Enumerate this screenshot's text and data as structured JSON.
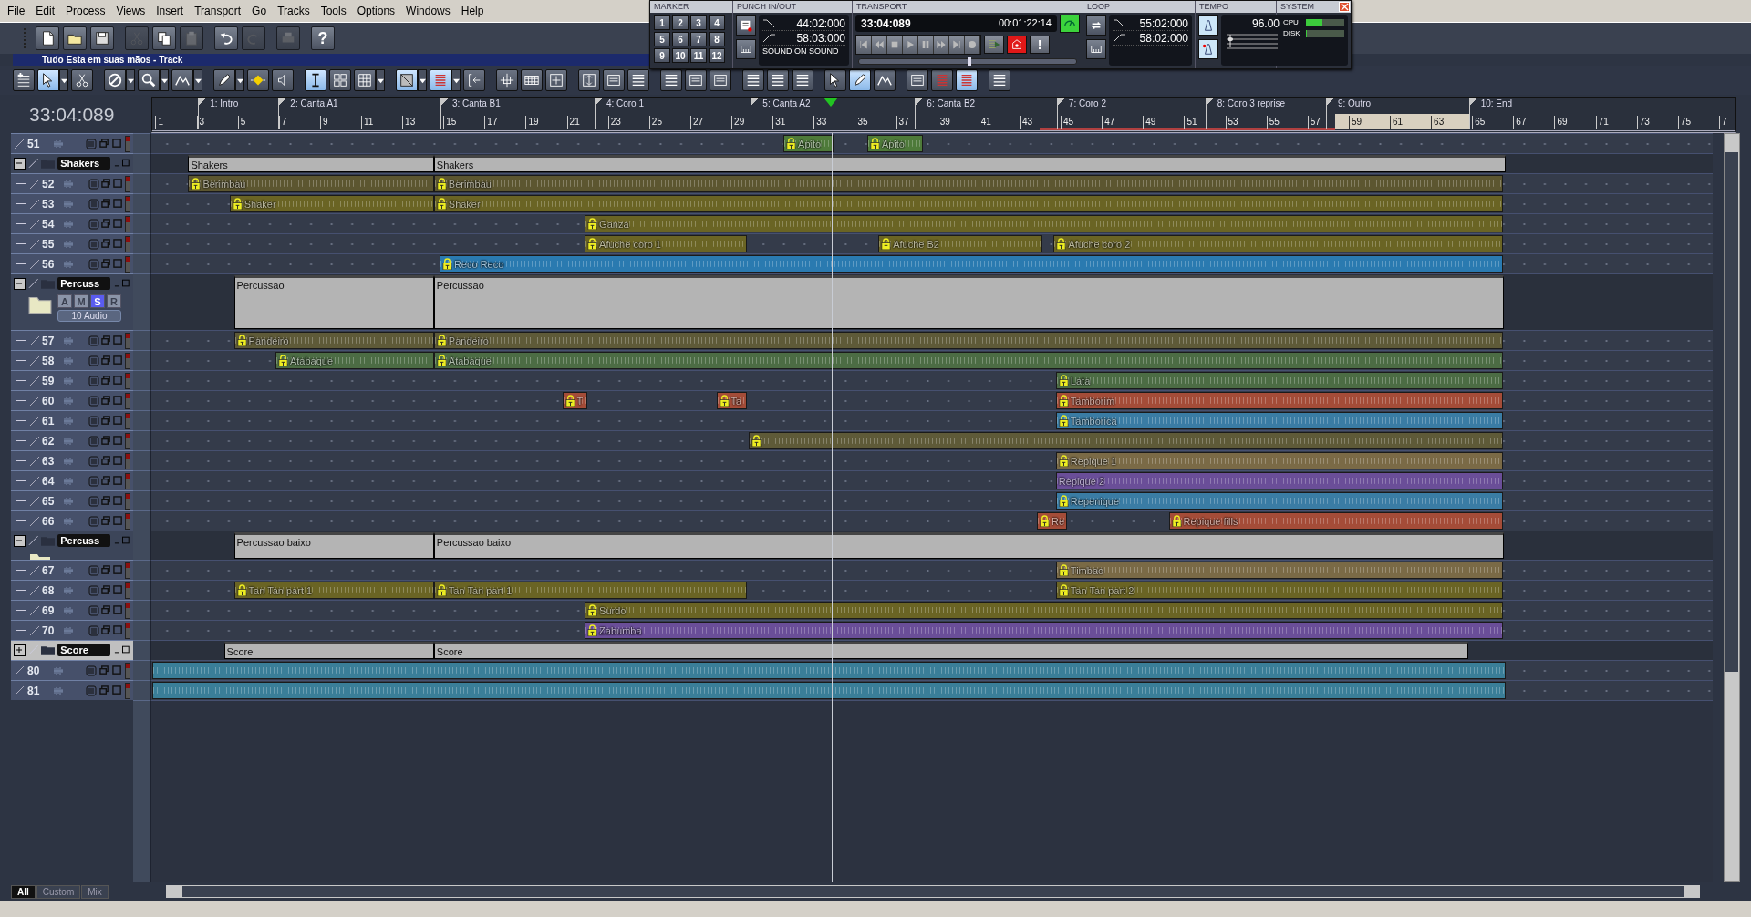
{
  "menu": [
    "File",
    "Edit",
    "Process",
    "Views",
    "Insert",
    "Transport",
    "Go",
    "Tracks",
    "Tools",
    "Options",
    "Windows",
    "Help"
  ],
  "toolbar": [
    {
      "kind": "new",
      "disabled": false
    },
    {
      "kind": "open",
      "disabled": false
    },
    {
      "kind": "save",
      "disabled": false
    },
    {
      "kind": "cut",
      "disabled": true
    },
    {
      "kind": "copy",
      "disabled": false
    },
    {
      "kind": "paste",
      "disabled": true
    },
    {
      "kind": "undo",
      "disabled": false
    },
    {
      "kind": "redo",
      "disabled": true
    },
    {
      "kind": "print",
      "disabled": true
    },
    {
      "kind": "help",
      "label": "?",
      "disabled": false
    }
  ],
  "document_title": "Tudo Esta em suas mãos - Track",
  "track_toolbar": [
    {
      "kind": "add-track",
      "dropdown": false,
      "selected": false
    },
    {
      "kind": "pointer",
      "dropdown": true,
      "selected": true
    },
    {
      "kind": "scissors",
      "dropdown": false,
      "selected": false
    },
    {
      "kind": "no-entry",
      "dropdown": true,
      "selected": false
    },
    {
      "kind": "search",
      "dropdown": true,
      "selected": false
    },
    {
      "kind": "curve",
      "dropdown": true,
      "selected": false
    },
    {
      "kind": "pencil",
      "dropdown": true,
      "selected": false
    },
    {
      "kind": "diamond",
      "dropdown": false,
      "selected": false
    },
    {
      "kind": "speaker",
      "dropdown": false,
      "selected": false
    },
    {
      "kind": "text-cursor",
      "dropdown": false,
      "selected": true
    },
    {
      "kind": "four-squares",
      "dropdown": false,
      "selected": false
    },
    {
      "kind": "grid",
      "dropdown": true,
      "selected": false
    },
    {
      "kind": "split-square",
      "dropdown": true,
      "selected": true
    },
    {
      "kind": "bars",
      "dropdown": true,
      "selected": true
    },
    {
      "kind": "bracket-arrow",
      "dropdown": false,
      "selected": false
    },
    {
      "kind": "move",
      "dropdown": false,
      "selected": false
    },
    {
      "kind": "film",
      "dropdown": false,
      "selected": false
    },
    {
      "kind": "expand-horizontal",
      "dropdown": false,
      "selected": false
    },
    {
      "kind": "expand-vertical",
      "dropdown": false,
      "selected": false
    },
    {
      "kind": "panel",
      "dropdown": false,
      "selected": false
    },
    {
      "kind": "list",
      "dropdown": false,
      "selected": false
    },
    {
      "kind": "list",
      "dropdown": false,
      "selected": false
    },
    {
      "kind": "panel",
      "dropdown": false,
      "selected": false
    },
    {
      "kind": "panel",
      "dropdown": false,
      "selected": false
    },
    {
      "kind": "list",
      "dropdown": false,
      "selected": false
    },
    {
      "kind": "list",
      "dropdown": false,
      "selected": false
    },
    {
      "kind": "list",
      "dropdown": false,
      "selected": false
    },
    {
      "kind": "pointer",
      "dropdown": false,
      "selected": false
    },
    {
      "kind": "pencil",
      "dropdown": false,
      "selected": true
    },
    {
      "kind": "curve",
      "dropdown": false,
      "selected": false
    },
    {
      "kind": "panel",
      "dropdown": false,
      "selected": false
    },
    {
      "kind": "bars",
      "dropdown": false,
      "selected": false
    },
    {
      "kind": "bars",
      "dropdown": false,
      "selected": true
    },
    {
      "kind": "list",
      "dropdown": false,
      "selected": false
    }
  ],
  "time_display": "33:04:089",
  "ruler": {
    "markers": [
      "1: Intro",
      "2: Canta A1",
      "3: Canta B1",
      "4: Coro 1",
      "5: Canta A2",
      "6: Canta B2",
      "7: Coro 2",
      "8: Coro 3 reprise",
      "9: Outro",
      "10: End"
    ],
    "measures": [
      "1",
      "3",
      "5",
      "7",
      "9",
      "11",
      "13",
      "15",
      "17",
      "19",
      "21",
      "23",
      "25",
      "27",
      "29",
      "31",
      "33",
      "35",
      "37",
      "39",
      "41",
      "43",
      "45",
      "47",
      "49",
      "51",
      "53",
      "55",
      "57",
      "59",
      "61",
      "63",
      "65",
      "67",
      "69",
      "71",
      "73",
      "75",
      "7"
    ]
  },
  "tracks": [
    {
      "kind": "track",
      "number": "51",
      "clips": [
        {
          "name": "Apito",
          "color": "#4e7a3a",
          "locked": true
        },
        {
          "name": "Apito",
          "color": "#4e7a3a",
          "locked": true
        }
      ]
    },
    {
      "kind": "folder",
      "name": "Shakers",
      "expanded": true,
      "clips": [
        {
          "name": "Shakers",
          "color": "#b4b4b4"
        },
        {
          "name": "Shakers",
          "color": "#b4b4b4"
        }
      ],
      "children": [
        {
          "kind": "track",
          "number": "52",
          "clips": [
            {
              "name": "Berimbau",
              "color": "#5c5630",
              "locked": true
            },
            {
              "name": "Berimbau",
              "color": "#5c5630",
              "locked": true
            }
          ]
        },
        {
          "kind": "track",
          "number": "53",
          "clips": [
            {
              "name": "Shaker",
              "color": "#6a6424",
              "locked": true
            },
            {
              "name": "Shaker",
              "color": "#6a6424",
              "locked": true
            }
          ]
        },
        {
          "kind": "track",
          "number": "54",
          "clips": [
            {
              "name": "Ganza",
              "color": "#6a6424",
              "locked": true
            }
          ]
        },
        {
          "kind": "track",
          "number": "55",
          "clips": [
            {
              "name": "Afuche coro 1",
              "color": "#6a6424",
              "locked": true
            },
            {
              "name": "Afuche B2",
              "color": "#6a6424",
              "locked": true
            },
            {
              "name": "Afuche coro 2",
              "color": "#6a6424",
              "locked": true
            }
          ]
        },
        {
          "kind": "track",
          "number": "56",
          "clips": [
            {
              "name": "Reco Reco",
              "color": "#2a7ab0",
              "locked": true
            }
          ]
        }
      ]
    },
    {
      "kind": "folder",
      "name": "Percuss",
      "expanded": true,
      "buttons": [
        {
          "label": "A",
          "on": false
        },
        {
          "label": "M",
          "on": false
        },
        {
          "label": "S",
          "on": true
        },
        {
          "label": "R",
          "on": false
        }
      ],
      "summary": "10 Audio",
      "clips": [
        {
          "name": "Percussao",
          "color": "#b4b4b4"
        },
        {
          "name": "Percussao",
          "color": "#b4b4b4"
        }
      ],
      "children": [
        {
          "kind": "track",
          "number": "57",
          "clips": [
            {
              "name": "Pandeiro",
              "color": "#5e5a38",
              "locked": true
            },
            {
              "name": "Pandeiro",
              "color": "#5e5a38",
              "locked": true
            }
          ]
        },
        {
          "kind": "track",
          "number": "58",
          "clips": [
            {
              "name": "Atabaque",
              "color": "#4c6c44",
              "locked": true
            },
            {
              "name": "Atabaque",
              "color": "#4c6c44",
              "locked": true
            }
          ]
        },
        {
          "kind": "track",
          "number": "59",
          "clips": [
            {
              "name": "Lata",
              "color": "#4c6c44",
              "locked": true
            }
          ]
        },
        {
          "kind": "track",
          "number": "60",
          "clips": [
            {
              "name": "T",
              "color": "#a44c38",
              "locked": true
            },
            {
              "name": "Ta",
              "color": "#a44c38",
              "locked": true
            },
            {
              "name": "Tamborim",
              "color": "#a44c38",
              "locked": true
            }
          ]
        },
        {
          "kind": "track",
          "number": "61",
          "clips": [
            {
              "name": "Tamborica",
              "color": "#3a7ca4",
              "locked": true
            }
          ]
        },
        {
          "kind": "track",
          "number": "62",
          "clips": [
            {
              "color": "#5e5a38",
              "locked": true
            }
          ]
        },
        {
          "kind": "track",
          "number": "63",
          "clips": [
            {
              "name": "Repique 1",
              "color": "#7a6a46",
              "locked": true
            }
          ]
        },
        {
          "kind": "track",
          "number": "64",
          "clips": [
            {
              "name": "Repique 2",
              "color": "#6a4e98",
              "locked": false
            }
          ]
        },
        {
          "kind": "track",
          "number": "65",
          "clips": [
            {
              "name": "Repenique",
              "color": "#3a7ca4",
              "locked": true
            }
          ]
        },
        {
          "kind": "track",
          "number": "66",
          "clips": [
            {
              "name": "Re",
              "color": "#a44c38",
              "locked": true
            },
            {
              "name": "Repique fills",
              "color": "#a44c38",
              "locked": true
            }
          ]
        }
      ]
    },
    {
      "kind": "folder",
      "name": "Percuss",
      "expanded": true,
      "clips": [
        {
          "name": "Percussao baixo",
          "color": "#b4b4b4"
        },
        {
          "name": "Percussao baixo",
          "color": "#b4b4b4"
        }
      ],
      "children": [
        {
          "kind": "track",
          "number": "67",
          "clips": [
            {
              "name": "Timbao",
              "color": "#7a6a46",
              "locked": true
            }
          ]
        },
        {
          "kind": "track",
          "number": "68",
          "clips": [
            {
              "name": "Tan Tan part 1",
              "color": "#6a6424",
              "locked": true
            },
            {
              "name": "Tan Tan part 1",
              "color": "#6a6424",
              "locked": true
            },
            {
              "name": "Tan Tan part 2",
              "color": "#6a6424",
              "locked": true
            }
          ]
        },
        {
          "kind": "track",
          "number": "69",
          "clips": [
            {
              "name": "Surdo",
              "color": "#6a6424",
              "locked": true
            }
          ]
        },
        {
          "kind": "track",
          "number": "70",
          "clips": [
            {
              "name": "Zabumba",
              "color": "#6a4e98",
              "locked": true
            }
          ]
        }
      ]
    },
    {
      "kind": "folder",
      "name": "Score",
      "expanded": false,
      "clips": [
        {
          "name": "Score",
          "color": "#b4b4b4"
        },
        {
          "name": "Score",
          "color": "#b4b4b4"
        }
      ]
    },
    {
      "kind": "track",
      "number": "80",
      "clips": [
        {
          "color": "#3a7e98",
          "locked": false
        }
      ]
    },
    {
      "kind": "track",
      "number": "81",
      "clips": [
        {
          "color": "#3a7e98",
          "locked": false
        }
      ]
    }
  ],
  "view_tabs": [
    {
      "label": "All",
      "selected": true
    },
    {
      "label": "Custom",
      "selected": false
    },
    {
      "label": "Mix",
      "selected": false
    }
  ],
  "control_bar": {
    "sections": [
      "MARKER",
      "PUNCH IN/OUT",
      "TRANSPORT",
      "LOOP",
      "TEMPO",
      "SYSTEM"
    ],
    "markers": [
      "1",
      "2",
      "3",
      "4",
      "5",
      "6",
      "7",
      "8",
      "9",
      "10",
      "11",
      "12"
    ],
    "punch": {
      "in": "44:02:000",
      "out": "58:03:000",
      "mode": "SOUND ON SOUND"
    },
    "transport": {
      "position": "33:04:089",
      "smpte": "00:01:22:14",
      "metronome_on": true,
      "record_armed": true,
      "alert": "!",
      "level": 0.51
    },
    "loop": {
      "start": "55:02:000",
      "end": "58:02:000"
    },
    "tempo": {
      "value": "96.00"
    },
    "system": [
      {
        "label": "CPU",
        "level": 0.42
      },
      {
        "label": "DISK",
        "level": 0.03
      }
    ]
  }
}
